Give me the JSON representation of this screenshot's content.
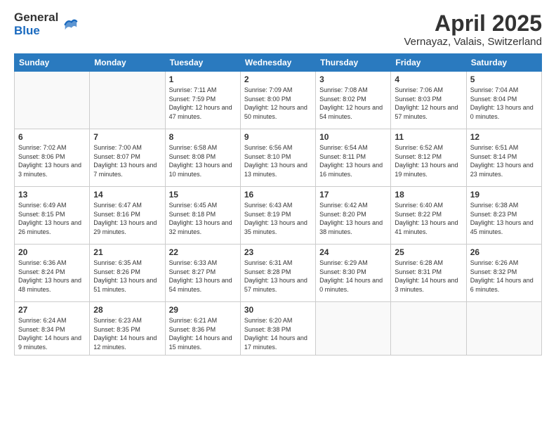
{
  "logo": {
    "general": "General",
    "blue": "Blue"
  },
  "title": "April 2025",
  "subtitle": "Vernayaz, Valais, Switzerland",
  "weekdays": [
    "Sunday",
    "Monday",
    "Tuesday",
    "Wednesday",
    "Thursday",
    "Friday",
    "Saturday"
  ],
  "weeks": [
    [
      {
        "day": "",
        "info": ""
      },
      {
        "day": "",
        "info": ""
      },
      {
        "day": "1",
        "info": "Sunrise: 7:11 AM\nSunset: 7:59 PM\nDaylight: 12 hours and 47 minutes."
      },
      {
        "day": "2",
        "info": "Sunrise: 7:09 AM\nSunset: 8:00 PM\nDaylight: 12 hours and 50 minutes."
      },
      {
        "day": "3",
        "info": "Sunrise: 7:08 AM\nSunset: 8:02 PM\nDaylight: 12 hours and 54 minutes."
      },
      {
        "day": "4",
        "info": "Sunrise: 7:06 AM\nSunset: 8:03 PM\nDaylight: 12 hours and 57 minutes."
      },
      {
        "day": "5",
        "info": "Sunrise: 7:04 AM\nSunset: 8:04 PM\nDaylight: 13 hours and 0 minutes."
      }
    ],
    [
      {
        "day": "6",
        "info": "Sunrise: 7:02 AM\nSunset: 8:06 PM\nDaylight: 13 hours and 3 minutes."
      },
      {
        "day": "7",
        "info": "Sunrise: 7:00 AM\nSunset: 8:07 PM\nDaylight: 13 hours and 7 minutes."
      },
      {
        "day": "8",
        "info": "Sunrise: 6:58 AM\nSunset: 8:08 PM\nDaylight: 13 hours and 10 minutes."
      },
      {
        "day": "9",
        "info": "Sunrise: 6:56 AM\nSunset: 8:10 PM\nDaylight: 13 hours and 13 minutes."
      },
      {
        "day": "10",
        "info": "Sunrise: 6:54 AM\nSunset: 8:11 PM\nDaylight: 13 hours and 16 minutes."
      },
      {
        "day": "11",
        "info": "Sunrise: 6:52 AM\nSunset: 8:12 PM\nDaylight: 13 hours and 19 minutes."
      },
      {
        "day": "12",
        "info": "Sunrise: 6:51 AM\nSunset: 8:14 PM\nDaylight: 13 hours and 23 minutes."
      }
    ],
    [
      {
        "day": "13",
        "info": "Sunrise: 6:49 AM\nSunset: 8:15 PM\nDaylight: 13 hours and 26 minutes."
      },
      {
        "day": "14",
        "info": "Sunrise: 6:47 AM\nSunset: 8:16 PM\nDaylight: 13 hours and 29 minutes."
      },
      {
        "day": "15",
        "info": "Sunrise: 6:45 AM\nSunset: 8:18 PM\nDaylight: 13 hours and 32 minutes."
      },
      {
        "day": "16",
        "info": "Sunrise: 6:43 AM\nSunset: 8:19 PM\nDaylight: 13 hours and 35 minutes."
      },
      {
        "day": "17",
        "info": "Sunrise: 6:42 AM\nSunset: 8:20 PM\nDaylight: 13 hours and 38 minutes."
      },
      {
        "day": "18",
        "info": "Sunrise: 6:40 AM\nSunset: 8:22 PM\nDaylight: 13 hours and 41 minutes."
      },
      {
        "day": "19",
        "info": "Sunrise: 6:38 AM\nSunset: 8:23 PM\nDaylight: 13 hours and 45 minutes."
      }
    ],
    [
      {
        "day": "20",
        "info": "Sunrise: 6:36 AM\nSunset: 8:24 PM\nDaylight: 13 hours and 48 minutes."
      },
      {
        "day": "21",
        "info": "Sunrise: 6:35 AM\nSunset: 8:26 PM\nDaylight: 13 hours and 51 minutes."
      },
      {
        "day": "22",
        "info": "Sunrise: 6:33 AM\nSunset: 8:27 PM\nDaylight: 13 hours and 54 minutes."
      },
      {
        "day": "23",
        "info": "Sunrise: 6:31 AM\nSunset: 8:28 PM\nDaylight: 13 hours and 57 minutes."
      },
      {
        "day": "24",
        "info": "Sunrise: 6:29 AM\nSunset: 8:30 PM\nDaylight: 14 hours and 0 minutes."
      },
      {
        "day": "25",
        "info": "Sunrise: 6:28 AM\nSunset: 8:31 PM\nDaylight: 14 hours and 3 minutes."
      },
      {
        "day": "26",
        "info": "Sunrise: 6:26 AM\nSunset: 8:32 PM\nDaylight: 14 hours and 6 minutes."
      }
    ],
    [
      {
        "day": "27",
        "info": "Sunrise: 6:24 AM\nSunset: 8:34 PM\nDaylight: 14 hours and 9 minutes."
      },
      {
        "day": "28",
        "info": "Sunrise: 6:23 AM\nSunset: 8:35 PM\nDaylight: 14 hours and 12 minutes."
      },
      {
        "day": "29",
        "info": "Sunrise: 6:21 AM\nSunset: 8:36 PM\nDaylight: 14 hours and 15 minutes."
      },
      {
        "day": "30",
        "info": "Sunrise: 6:20 AM\nSunset: 8:38 PM\nDaylight: 14 hours and 17 minutes."
      },
      {
        "day": "",
        "info": ""
      },
      {
        "day": "",
        "info": ""
      },
      {
        "day": "",
        "info": ""
      }
    ]
  ]
}
